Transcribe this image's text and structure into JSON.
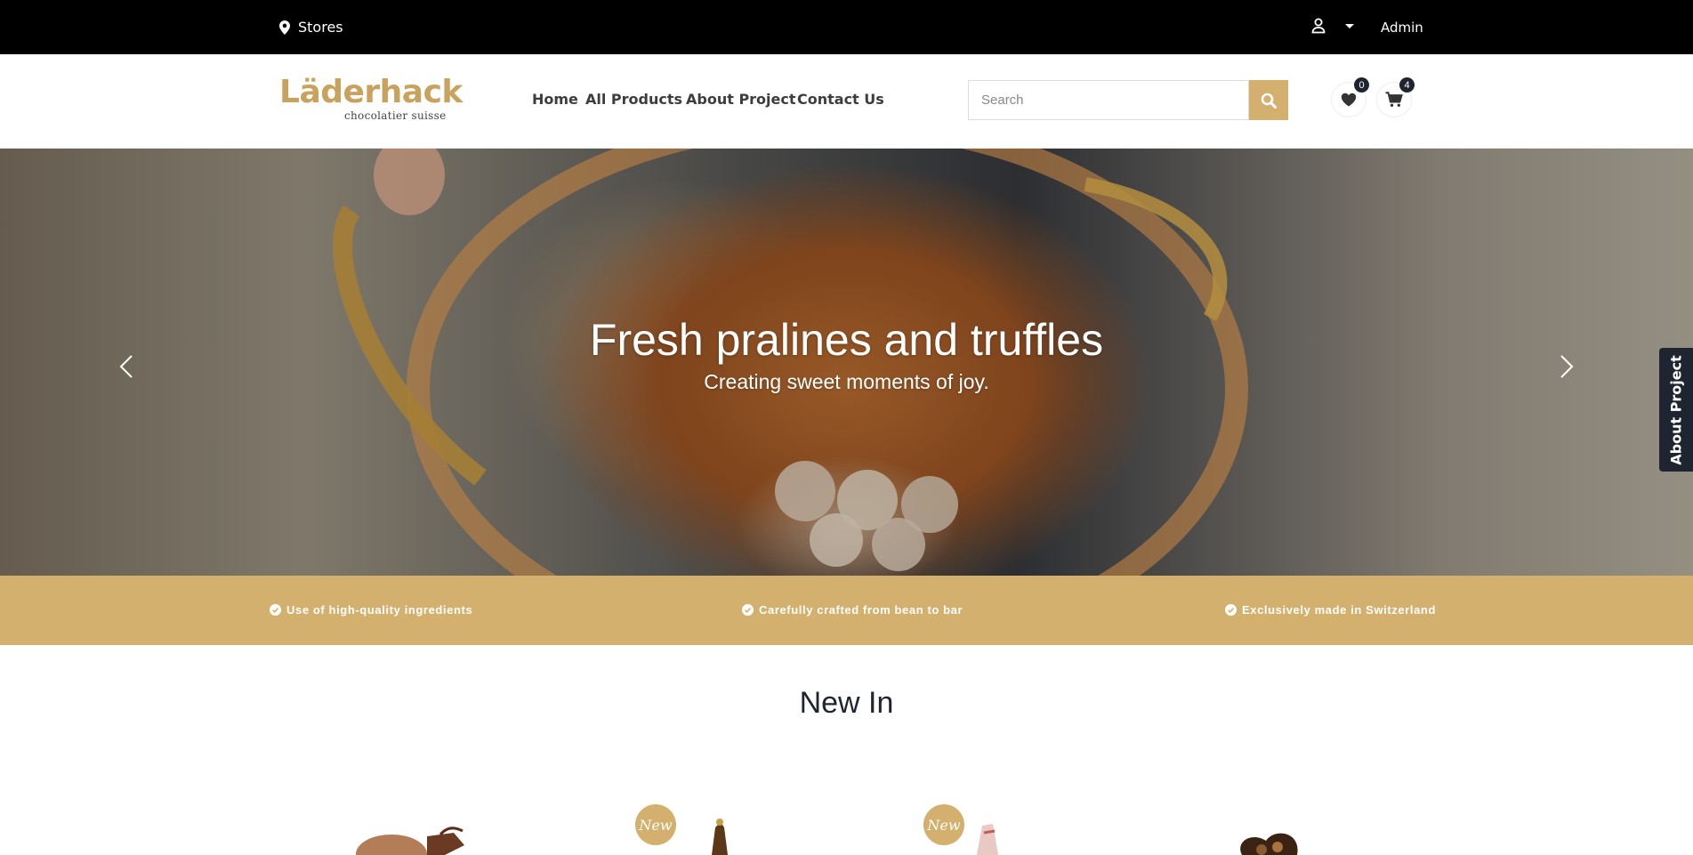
{
  "topbar": {
    "stores_label": "Stores",
    "account_label": "Admin"
  },
  "header": {
    "logo_main": "Läderhack",
    "logo_sub": "chocolatier suisse",
    "nav": [
      "Home",
      "All Products",
      "About Project",
      "Contact Us"
    ],
    "search_placeholder": "Search",
    "wishlist_count": "0",
    "cart_count": "4"
  },
  "hero": {
    "title": "Fresh pralines and truffles",
    "subtitle": "Creating sweet moments of joy."
  },
  "features": [
    "Use of high-quality ingredients",
    "Carefully crafted from bean to bar",
    "Exclusively made in Switzerland"
  ],
  "section": {
    "new_in_title": "New In",
    "new_badge_label": "New"
  },
  "side_tab": {
    "label": "About Project"
  },
  "colors": {
    "accent": "#d4b06e",
    "logo": "#c9a25d",
    "topbar": "#000000",
    "dark": "#1e2530"
  },
  "icons": {
    "stores": "map-pin-icon",
    "user": "user-icon",
    "search": "search-icon",
    "wishlist": "heart-icon",
    "cart": "cart-icon",
    "prev": "chevron-left-icon",
    "next": "chevron-right-icon",
    "feature": "check-circle-icon"
  }
}
